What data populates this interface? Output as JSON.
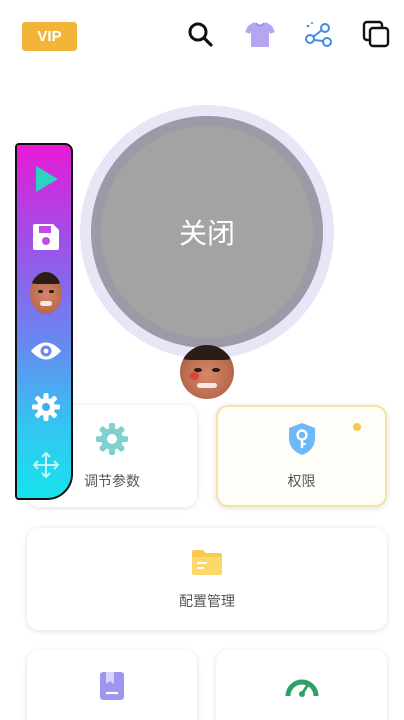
{
  "top_bar": {
    "vip_label": "VIP",
    "icons": [
      "search-icon",
      "shirt-icon",
      "share-icon",
      "window-icon"
    ]
  },
  "power": {
    "label": "关闭"
  },
  "side_toolbar": {
    "icons": [
      "play-icon",
      "save-icon",
      "avatar",
      "eye-icon",
      "gear-icon",
      "move-icon"
    ]
  },
  "cards": {
    "params": {
      "label": "调节参数",
      "icon": "gear-icon"
    },
    "permissions": {
      "label": "权限",
      "icon": "shield-key-icon"
    },
    "config": {
      "label": "配置管理",
      "icon": "folder-icon"
    },
    "bottom_left": {
      "label": "",
      "icon": "bookmark-icon"
    },
    "bottom_right": {
      "label": "",
      "icon": "speedometer-icon"
    }
  },
  "colors": {
    "vip": "#f2b53a",
    "toolbar_top": "#e81ad6",
    "toolbar_bottom": "#16e3ec",
    "power_button": "#a3a3a3",
    "accent_teal": "#6fc9c9",
    "accent_blue": "#5aaef5",
    "accent_yellow": "#f5c74a"
  }
}
